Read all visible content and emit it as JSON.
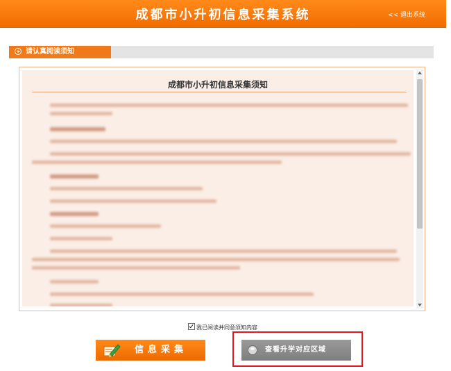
{
  "header": {
    "title": "成都市小升初信息采集系统",
    "logout": "<< 退出系统"
  },
  "section": {
    "tab_label": "请认真阅读须知"
  },
  "notice": {
    "title": "成都市小升初信息采集须知"
  },
  "agree": {
    "label": "我已阅读并同意须知内容",
    "checked": true
  },
  "buttons": {
    "collect_label": "信息采集",
    "query_label": "查看升学对应区域"
  },
  "colors": {
    "accent": "#f26c00",
    "highlight": "#e6141e",
    "notice_bg": "#fbeee6"
  }
}
